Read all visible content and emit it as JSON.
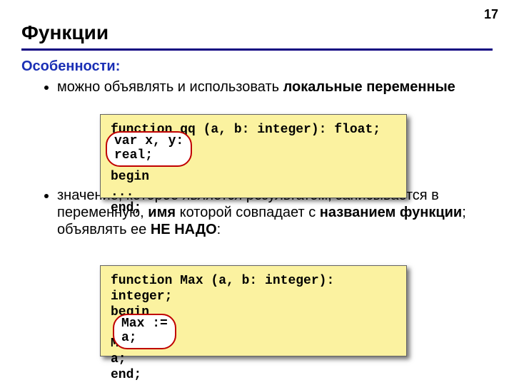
{
  "page_number": "17",
  "title": "Функции",
  "subheader": "Особенности:",
  "bullet1_pre": "можно объявлять и использовать ",
  "bullet1_strong": "локальные переменные",
  "bullet2_pre": "значение, которое является результатом, записывается в переменную, ",
  "bullet2_mid": "имя",
  "bullet2_mid2": " которой совпадает с ",
  "bullet2_strong2": "названием функции",
  "bullet2_post": "; объявлять ее ",
  "bullet2_strong3": "НЕ НАДО",
  "bullet2_tail": ":",
  "code1": {
    "l1": "function qq (a, b: integer): float;",
    "l2a": "var x, y:",
    "l2b": "real;",
    "l3": "begin",
    "l4": " ...",
    "l5": "end;"
  },
  "code2": {
    "l1": "function Max (a, b: integer): integer;",
    "l2": "begin",
    "l3": " ...",
    "l4": " Max :=",
    "l4b": " a;",
    "l5": "end;"
  },
  "highlight1_line1": "var x, y:",
  "highlight1_line2": "real;",
  "highlight2_line1": "Max :=",
  "highlight2_line2": "a;"
}
